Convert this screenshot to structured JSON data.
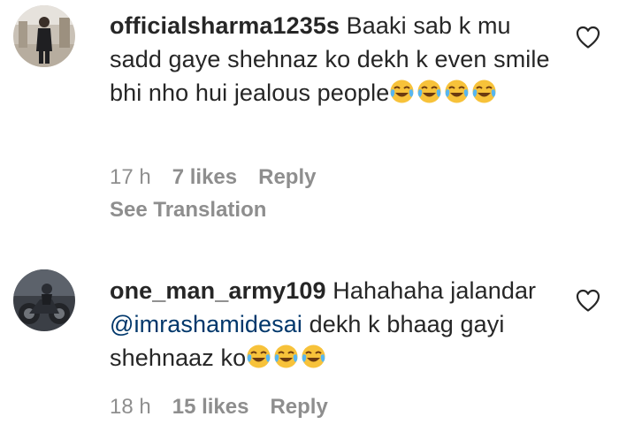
{
  "comments": [
    {
      "username": "officialsharma1235s",
      "text": "Baaki sab k mu sadd gaye shehnaz ko dekh k even smile bhi nho hui jealous people",
      "emoji_count": 4,
      "emoji": "face-with-tears-of-joy",
      "time": "17 h",
      "likes": "7 likes",
      "reply_label": "Reply",
      "translation_label": "See Translation",
      "liked": false
    },
    {
      "username": "one_man_army109",
      "text_before_mention": "Hahahaha jalandar ",
      "mention": "@imrashamidesai",
      "text_after_mention": " dekh k bhaag gayi shehnaaz ko",
      "emoji_count": 3,
      "emoji": "face-with-tears-of-joy",
      "time": "18 h",
      "likes": "15 likes",
      "reply_label": "Reply",
      "liked": false
    }
  ],
  "colors": {
    "text": "#262626",
    "secondary": "#8e8e8e",
    "mention": "#00376b",
    "background": "#ffffff"
  },
  "icons": {
    "like": "heart-outline-icon",
    "emoji": "face-with-tears-of-joy-icon"
  }
}
